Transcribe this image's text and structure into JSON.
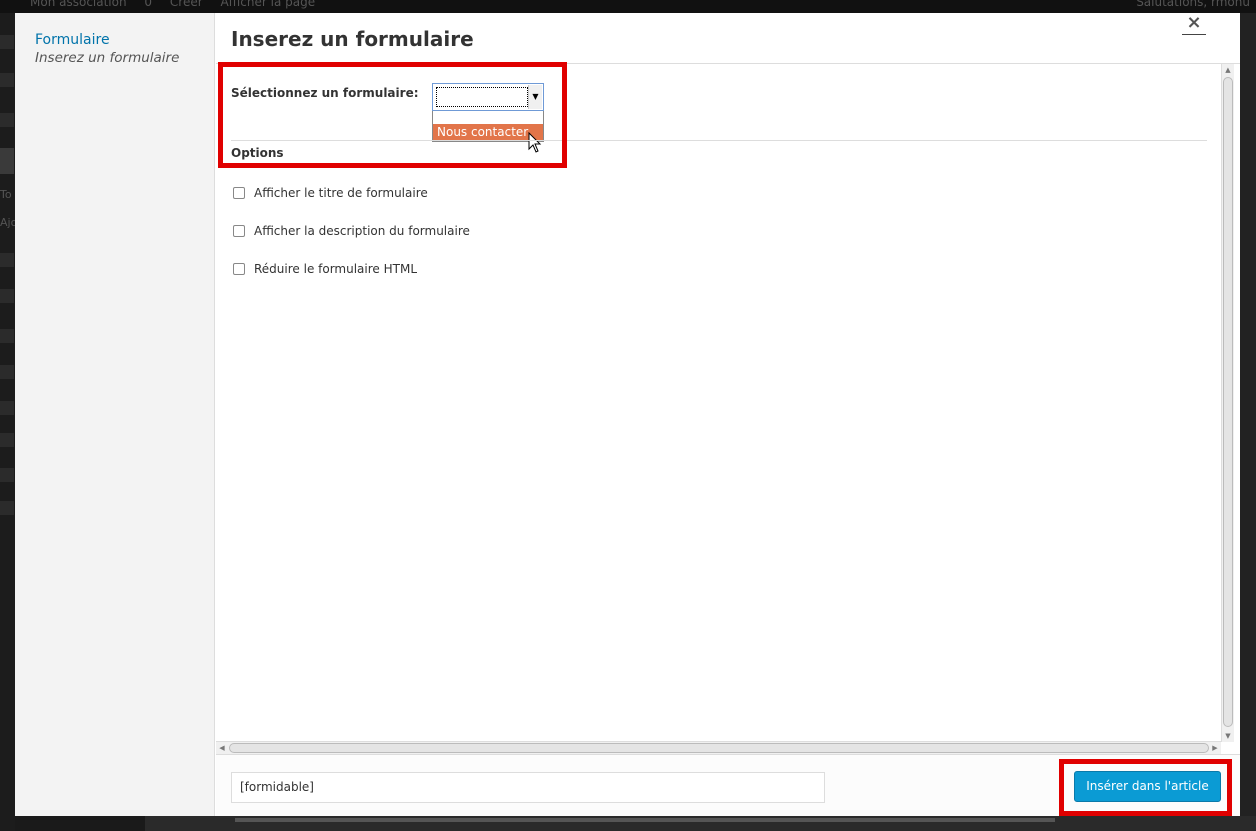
{
  "adminbar": {
    "site": "Mon association",
    "comments": "0",
    "new": "Créer",
    "view": "Afficher la page",
    "greeting": "Salutations, rmonu"
  },
  "sidebar": {
    "menu_title": "Formulaire",
    "menu_sub": "Inserez un formulaire",
    "bg_texts": [
      "To",
      "Ajo"
    ]
  },
  "modal": {
    "title": "Inserez un formulaire",
    "close": "×"
  },
  "form": {
    "select_label": "Sélectionnez un formulaire:",
    "select_value": "",
    "dropdown_options": [
      "",
      "Nous contacter"
    ],
    "highlighted_option": "Nous contacter",
    "options_label": "Options",
    "checkboxes": [
      {
        "label": "Afficher le titre de formulaire",
        "checked": false
      },
      {
        "label": "Afficher la description du formulaire",
        "checked": false
      },
      {
        "label": "Réduire le formulaire HTML",
        "checked": false
      }
    ]
  },
  "footer": {
    "shortcode": "[formidable]",
    "insert_label": "Insérer dans l'article"
  },
  "colors": {
    "accent_blue": "#0b9bd4",
    "link_blue": "#0073aa",
    "highlight_option": "#e2754a",
    "annotation_red": "#e00000"
  }
}
